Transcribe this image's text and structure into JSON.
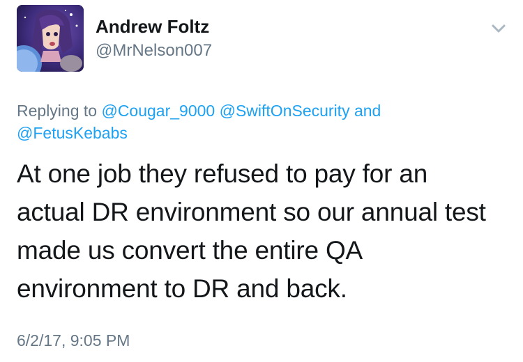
{
  "tweet": {
    "author": {
      "display_name": "Andrew Foltz",
      "handle": "@MrNelson007",
      "avatar_icon": "avatar-image"
    },
    "caret_icon": "chevron-down-icon",
    "replying": {
      "prefix": "Replying to",
      "mentions": [
        "@Cougar_9000",
        "@SwiftOnSecurity"
      ],
      "connector": "and",
      "last_mention": "@FetusKebabs"
    },
    "text_lines": [
      "At one job they refused to pay for an",
      "actual DR environment so our annual test",
      "made us convert the entire QA",
      "environment to DR and back."
    ],
    "timestamp": "6/2/17, 9:05 PM"
  },
  "colors": {
    "text": "#14171a",
    "secondary": "#657786",
    "link": "#1da1f2",
    "caret": "#aab8c2"
  }
}
